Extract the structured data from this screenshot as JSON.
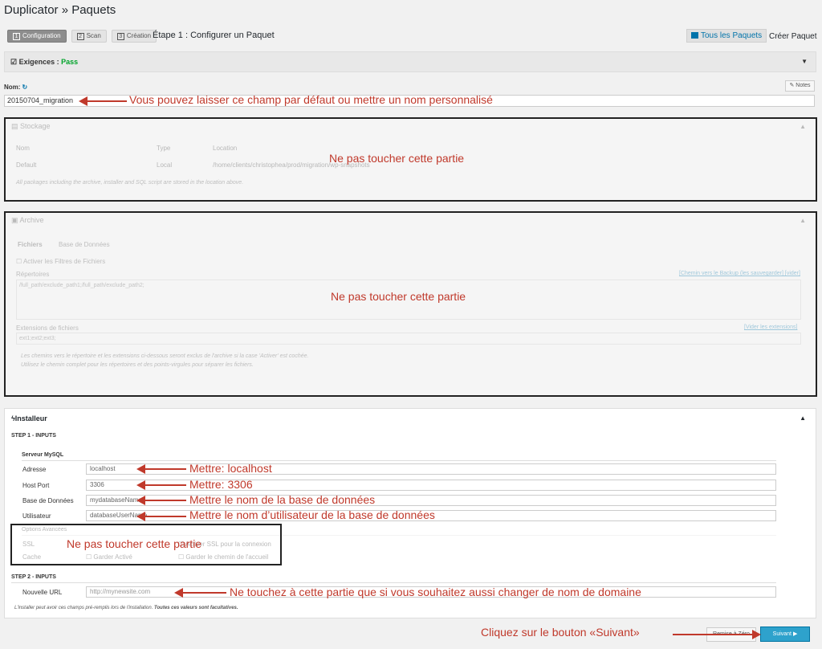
{
  "header": {
    "title": "Duplicator » Paquets",
    "steps": [
      {
        "num": "1",
        "label": "Configuration"
      },
      {
        "num": "2",
        "label": "Scan"
      },
      {
        "num": "3",
        "label": "Création"
      }
    ],
    "step_title": "Étape 1 : Configurer un Paquet",
    "all_packages": "Tous les Paquets",
    "create_package": "Créer Paquet"
  },
  "requirements": {
    "label": "Exigences :",
    "status": "Pass"
  },
  "name": {
    "label": "Nom:",
    "value": "20150704_migration",
    "notes": "Notes"
  },
  "storage": {
    "title": "Stockage",
    "columns": [
      "Nom",
      "Type",
      "Location"
    ],
    "row": {
      "name": "Default",
      "type": "Local",
      "location": "/home/clients/christophea/prod/migration/wp-snapshots"
    },
    "note": "All packages including the archive, installer and SQL script are stored in the location above."
  },
  "archive": {
    "title": "Archive",
    "tabs": [
      "Fichiers",
      "Base de Données"
    ],
    "enable_filters": "Activer les Filtres de Fichiers",
    "dirs_label": "Répertoires",
    "dirs_link": "[Chemin vers le Backup (les sauvegarder] [vider]",
    "dirs_value": "/full_path/exclude_path1;/full_path/exclude_path2;",
    "ext_label": "Extensions de fichiers",
    "ext_link": "[Vider les extensions]",
    "ext_value": "ext1;ext2;ext3;",
    "note_1": "Les chemins vers le répertoire et les extensions ci-dessous seront exclus de l'archive si la case 'Activer' est cochée.",
    "note_2": "Utilisez le chemin complet pour les répertoires et des points-virgules pour séparer les fichiers."
  },
  "installer": {
    "title": "Installeur",
    "step1": "STEP 1 - INPUTS",
    "mysql_server": "Serveur MySQL",
    "fields": [
      {
        "label": "Adresse",
        "value": "localhost"
      },
      {
        "label": "Host Port",
        "value": "3306"
      },
      {
        "label": "Base de Données",
        "value": "mydatabaseName"
      },
      {
        "label": "Utilisateur",
        "value": "databaseUserName"
      }
    ],
    "advanced": "Options Avancées",
    "ssl_label": "SSL",
    "ssl_option": "Activer SSL pour la connexion",
    "cache_label": "Cache",
    "cache_opt1": "Garder Activé",
    "cache_opt2": "Garder le chemin de l'accueil",
    "step2": "STEP 2 - INPUTS",
    "url_label": "Nouvelle URL",
    "url_placeholder": "http://mynewsite.com",
    "footnote_1": "L'installer peut avoir ces champs pré-remplis lors de l'installation.",
    "footnote_2": "Toutes ces valeurs sont facultatives."
  },
  "buttons": {
    "reset": "Remise à Zéro",
    "next": "Suivant ▶"
  },
  "annotations": {
    "name": "Vous pouvez laisser ce champ par défaut ou mettre un nom personnalisé",
    "storage": "Ne pas toucher cette partie",
    "archive": "Ne pas toucher cette partie",
    "address": "Mettre: localhost",
    "port": "Mettre: 3306",
    "db": "Mettre le nom de la base de données",
    "user": "Mettre le nom d’utilisateur de la base de données",
    "advanced": "Ne pas toucher cette partie",
    "url": "Ne touchez à cette partie que si vous souhaitez aussi changer de nom de domaine",
    "next": "Cliquez sur le bouton «Suivant»"
  },
  "colors": {
    "accent": "#0073aa",
    "annotation": "#c0392b",
    "pass": "#00a32a",
    "button": "#2ea2cc"
  }
}
